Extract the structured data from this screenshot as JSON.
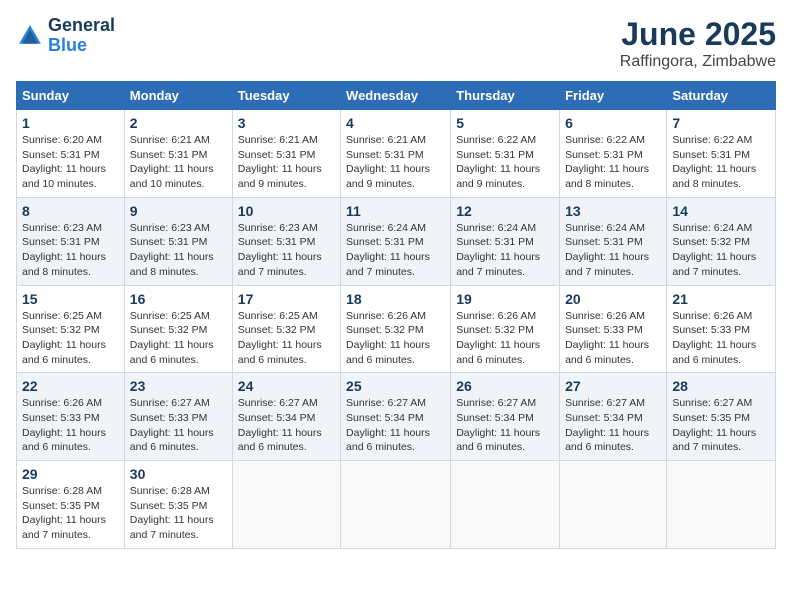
{
  "header": {
    "logo_line1": "General",
    "logo_line2": "Blue",
    "main_title": "June 2025",
    "subtitle": "Raffingora, Zimbabwe"
  },
  "calendar": {
    "days_of_week": [
      "Sunday",
      "Monday",
      "Tuesday",
      "Wednesday",
      "Thursday",
      "Friday",
      "Saturday"
    ],
    "weeks": [
      [
        null,
        {
          "num": "2",
          "sunrise": "6:21 AM",
          "sunset": "5:31 PM",
          "daylight": "11 hours and 10 minutes."
        },
        {
          "num": "3",
          "sunrise": "6:21 AM",
          "sunset": "5:31 PM",
          "daylight": "11 hours and 9 minutes."
        },
        {
          "num": "4",
          "sunrise": "6:21 AM",
          "sunset": "5:31 PM",
          "daylight": "11 hours and 9 minutes."
        },
        {
          "num": "5",
          "sunrise": "6:22 AM",
          "sunset": "5:31 PM",
          "daylight": "11 hours and 9 minutes."
        },
        {
          "num": "6",
          "sunrise": "6:22 AM",
          "sunset": "5:31 PM",
          "daylight": "11 hours and 8 minutes."
        },
        {
          "num": "7",
          "sunrise": "6:22 AM",
          "sunset": "5:31 PM",
          "daylight": "11 hours and 8 minutes."
        }
      ],
      [
        {
          "num": "1",
          "sunrise": "6:20 AM",
          "sunset": "5:31 PM",
          "daylight": "11 hours and 10 minutes."
        },
        null,
        null,
        null,
        null,
        null,
        null
      ],
      [
        {
          "num": "8",
          "sunrise": "6:23 AM",
          "sunset": "5:31 PM",
          "daylight": "11 hours and 8 minutes."
        },
        {
          "num": "9",
          "sunrise": "6:23 AM",
          "sunset": "5:31 PM",
          "daylight": "11 hours and 8 minutes."
        },
        {
          "num": "10",
          "sunrise": "6:23 AM",
          "sunset": "5:31 PM",
          "daylight": "11 hours and 7 minutes."
        },
        {
          "num": "11",
          "sunrise": "6:24 AM",
          "sunset": "5:31 PM",
          "daylight": "11 hours and 7 minutes."
        },
        {
          "num": "12",
          "sunrise": "6:24 AM",
          "sunset": "5:31 PM",
          "daylight": "11 hours and 7 minutes."
        },
        {
          "num": "13",
          "sunrise": "6:24 AM",
          "sunset": "5:31 PM",
          "daylight": "11 hours and 7 minutes."
        },
        {
          "num": "14",
          "sunrise": "6:24 AM",
          "sunset": "5:32 PM",
          "daylight": "11 hours and 7 minutes."
        }
      ],
      [
        {
          "num": "15",
          "sunrise": "6:25 AM",
          "sunset": "5:32 PM",
          "daylight": "11 hours and 6 minutes."
        },
        {
          "num": "16",
          "sunrise": "6:25 AM",
          "sunset": "5:32 PM",
          "daylight": "11 hours and 6 minutes."
        },
        {
          "num": "17",
          "sunrise": "6:25 AM",
          "sunset": "5:32 PM",
          "daylight": "11 hours and 6 minutes."
        },
        {
          "num": "18",
          "sunrise": "6:26 AM",
          "sunset": "5:32 PM",
          "daylight": "11 hours and 6 minutes."
        },
        {
          "num": "19",
          "sunrise": "6:26 AM",
          "sunset": "5:32 PM",
          "daylight": "11 hours and 6 minutes."
        },
        {
          "num": "20",
          "sunrise": "6:26 AM",
          "sunset": "5:33 PM",
          "daylight": "11 hours and 6 minutes."
        },
        {
          "num": "21",
          "sunrise": "6:26 AM",
          "sunset": "5:33 PM",
          "daylight": "11 hours and 6 minutes."
        }
      ],
      [
        {
          "num": "22",
          "sunrise": "6:26 AM",
          "sunset": "5:33 PM",
          "daylight": "11 hours and 6 minutes."
        },
        {
          "num": "23",
          "sunrise": "6:27 AM",
          "sunset": "5:33 PM",
          "daylight": "11 hours and 6 minutes."
        },
        {
          "num": "24",
          "sunrise": "6:27 AM",
          "sunset": "5:34 PM",
          "daylight": "11 hours and 6 minutes."
        },
        {
          "num": "25",
          "sunrise": "6:27 AM",
          "sunset": "5:34 PM",
          "daylight": "11 hours and 6 minutes."
        },
        {
          "num": "26",
          "sunrise": "6:27 AM",
          "sunset": "5:34 PM",
          "daylight": "11 hours and 6 minutes."
        },
        {
          "num": "27",
          "sunrise": "6:27 AM",
          "sunset": "5:34 PM",
          "daylight": "11 hours and 6 minutes."
        },
        {
          "num": "28",
          "sunrise": "6:27 AM",
          "sunset": "5:35 PM",
          "daylight": "11 hours and 7 minutes."
        }
      ],
      [
        {
          "num": "29",
          "sunrise": "6:28 AM",
          "sunset": "5:35 PM",
          "daylight": "11 hours and 7 minutes."
        },
        {
          "num": "30",
          "sunrise": "6:28 AM",
          "sunset": "5:35 PM",
          "daylight": "11 hours and 7 minutes."
        },
        null,
        null,
        null,
        null,
        null
      ]
    ]
  }
}
